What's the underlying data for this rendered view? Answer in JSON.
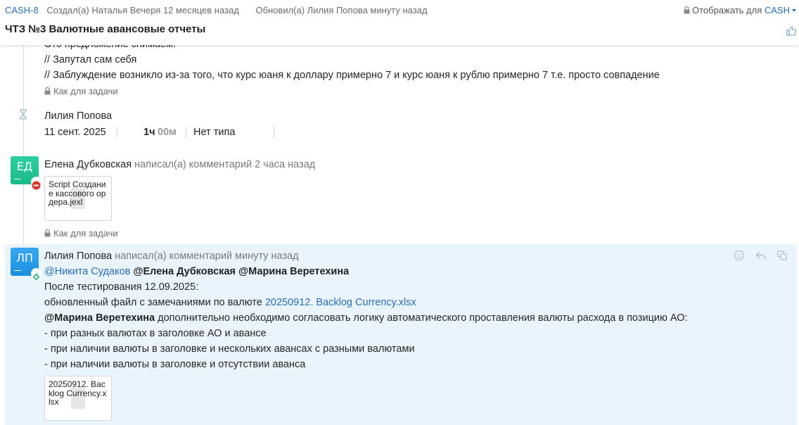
{
  "header": {
    "issue_key": "CASH-8",
    "created": "Создал(а) Наталья Вечеря 12 месяцев назад",
    "updated": "Обновил(а) Лилия Попова минуту назад",
    "visibility_label": "Отображать для",
    "visibility_project": "CASH",
    "title": "ЧТЗ №3 Валютные авансовые отчеты"
  },
  "prev_comment": {
    "line1_partial": "Это предложение снимаем.",
    "line2": "// Запутал сам себя",
    "line3": "// Заблуждение возникло из-за того, что курс юаня к доллару примерно 7 и курс юаня к рублю примерно 7 т.е. просто совпадение",
    "scope": "Как для задачи"
  },
  "worklog": {
    "author": "Лилия Попова",
    "date": "11 сент. 2025",
    "hours": "1ч",
    "minutes": "00м",
    "type": "Нет типа"
  },
  "comment1": {
    "avatar_initials": "ЕД",
    "author": "Елена Дубковская",
    "action": "написал(а) комментарий 2 часа назад",
    "attachment": "Script Создание кассового ордера.jexl",
    "scope": "Как для задачи"
  },
  "comment2": {
    "avatar_initials": "ЛП",
    "author": "Лилия Попова",
    "action": "написал(а) комментарий минуту назад",
    "mention_link": "@Никита Судаков",
    "mention_2": "@Елена Дубковская",
    "mention_3": "@Марина Веретехина",
    "line_after_test": "После тестирования 12.09.2025:",
    "line_file_prefix": "обновленный файл с замечаниями по валюте",
    "file_link": "20250912. Backlog Currency.xlsx",
    "mention_4": "@Марина Веретехина",
    "line_extra": "дополнительно необходимо согласовать логику автоматического проставления валюты расхода в позицию АО:",
    "bullets": [
      "- при разных валютах в заголовке АО и авансе",
      "- при наличии валюты в заголовке и нескольких авансах с разными валютами",
      "- при наличии валюты в заголовке и отсутствии аванса"
    ],
    "attachment": "20250912. Backlog Currency.xlsx"
  },
  "colors": {
    "link": "#2a6db8",
    "highlight_bg": "#e9f4fc",
    "avatar_ed": "#18b98a",
    "avatar_lp": "#1b8fe0"
  },
  "icons": [
    "lock-icon",
    "thumbs-up-icon",
    "hourglass-icon",
    "emoji-icon",
    "reply-icon",
    "copy-icon"
  ]
}
